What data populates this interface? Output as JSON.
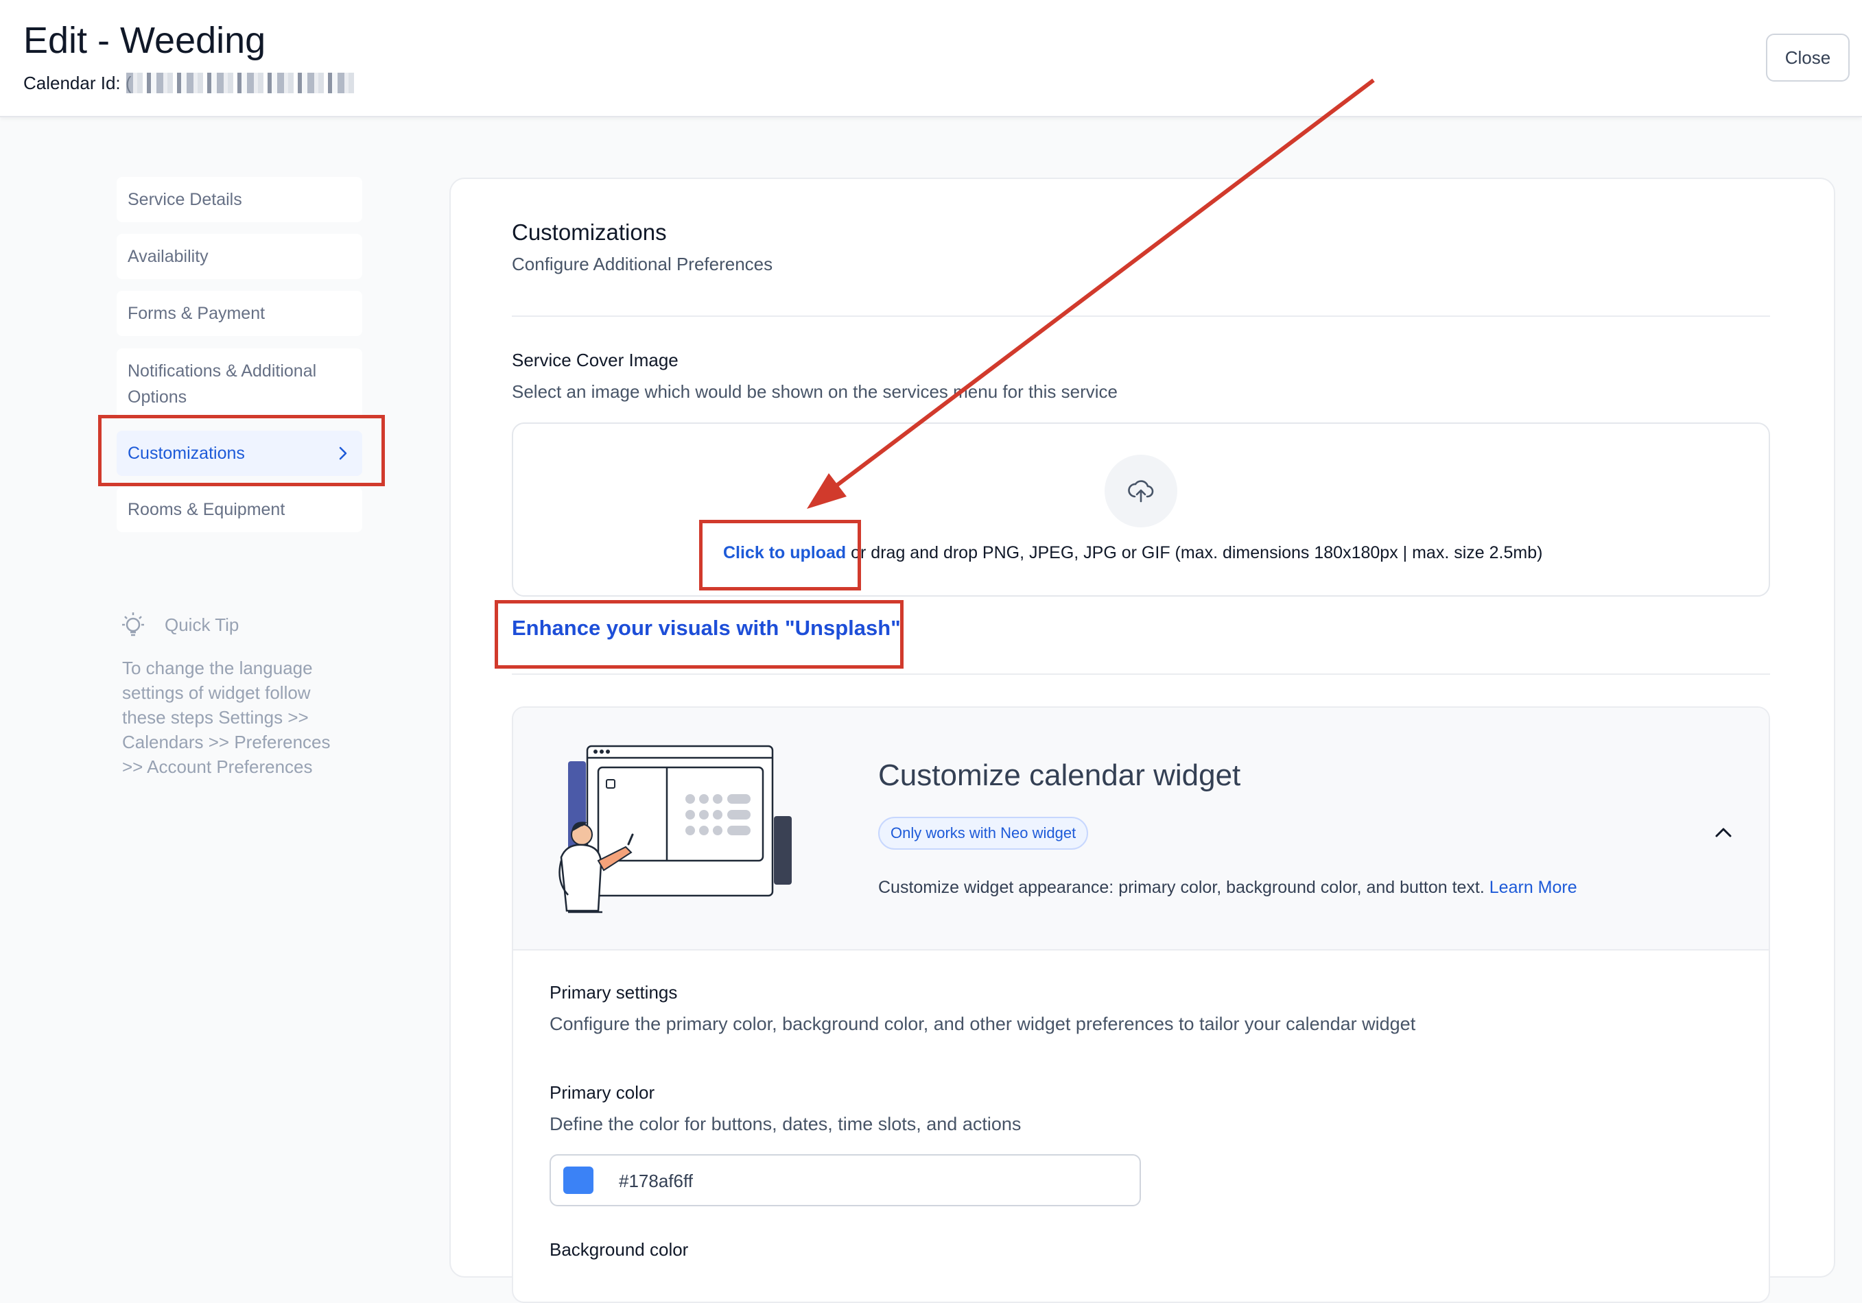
{
  "header": {
    "title": "Edit - Weeding",
    "calendar_id_label": "Calendar Id: (",
    "close_label": "Close"
  },
  "sidebar": {
    "items": [
      {
        "label": "Service Details"
      },
      {
        "label": "Availability"
      },
      {
        "label": "Forms & Payment"
      },
      {
        "label": "Notifications & Additional Options"
      },
      {
        "label": "Customizations",
        "active": true
      },
      {
        "label": "Rooms & Equipment"
      }
    ],
    "quick_tip": {
      "icon": "lightbulb-icon",
      "title": "Quick Tip",
      "text": "To change the language settings of widget follow these steps Settings >> Calendars >> Preferences >> Account Preferences"
    }
  },
  "main": {
    "title": "Customizations",
    "subtitle": "Configure Additional Preferences",
    "cover_image": {
      "title": "Service Cover Image",
      "description": "Select an image which would be shown on the services menu for this service",
      "upload_icon": "cloud-upload-icon",
      "upload_link": "Click to upload",
      "upload_text": " or drag and drop PNG, JPEG, JPG or GIF (max. dimensions 180x180px | max. size 2.5mb)"
    },
    "unsplash_link": "Enhance your visuals with \"Unsplash\"",
    "widget": {
      "title": "Customize calendar widget",
      "badge": "Only works with Neo widget",
      "description": "Customize widget appearance: primary color, background color, and button text. ",
      "learn_more": "Learn More",
      "expanded": true,
      "primary_settings": {
        "title": "Primary settings",
        "description": "Configure the primary color, background color, and other widget preferences to tailor your calendar widget"
      },
      "primary_color": {
        "title": "Primary color",
        "description": "Define the color for buttons, dates, time slots, and actions",
        "value": "#178af6ff",
        "swatch": "#3b82f6"
      },
      "background_color": {
        "title": "Background color"
      }
    }
  },
  "colors": {
    "accent": "#1d5ad8",
    "annotation_red": "#d13a2c"
  }
}
